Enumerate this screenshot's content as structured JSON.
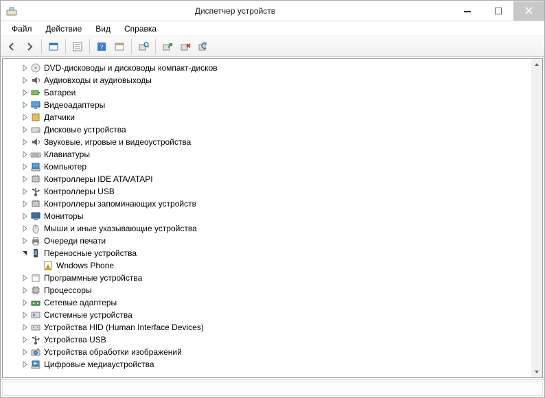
{
  "window": {
    "title": "Диспетчер устройств"
  },
  "menu": {
    "file": "Файл",
    "action": "Действие",
    "view": "Вид",
    "help": "Справка"
  },
  "tree": {
    "items": [
      {
        "label": "DVD-дисководы и дисководы компакт-дисков",
        "expanded": false,
        "icon": "disc"
      },
      {
        "label": "Аудиовходы и аудиовыходы",
        "expanded": false,
        "icon": "speaker"
      },
      {
        "label": "Батареи",
        "expanded": false,
        "icon": "battery"
      },
      {
        "label": "Видеоадаптеры",
        "expanded": false,
        "icon": "display"
      },
      {
        "label": "Датчики",
        "expanded": false,
        "icon": "sensor"
      },
      {
        "label": "Дисковые устройства",
        "expanded": false,
        "icon": "drive"
      },
      {
        "label": "Звуковые, игровые и видеоустройства",
        "expanded": false,
        "icon": "speaker"
      },
      {
        "label": "Клавиатуры",
        "expanded": false,
        "icon": "keyboard"
      },
      {
        "label": "Компьютер",
        "expanded": false,
        "icon": "computer"
      },
      {
        "label": "Контроллеры IDE ATA/ATAPI",
        "expanded": false,
        "icon": "controller"
      },
      {
        "label": "Контроллеры USB",
        "expanded": false,
        "icon": "usb"
      },
      {
        "label": "Контроллеры запоминающих устройств",
        "expanded": false,
        "icon": "controller"
      },
      {
        "label": "Мониторы",
        "expanded": false,
        "icon": "monitor"
      },
      {
        "label": "Мыши и иные указывающие устройства",
        "expanded": false,
        "icon": "mouse"
      },
      {
        "label": "Очереди печати",
        "expanded": false,
        "icon": "printer"
      },
      {
        "label": "Переносные устройства",
        "expanded": true,
        "icon": "portable",
        "children": [
          {
            "label": "Wndows Phone",
            "icon": "warning"
          }
        ]
      },
      {
        "label": "Программные устройства",
        "expanded": false,
        "icon": "software"
      },
      {
        "label": "Процессоры",
        "expanded": false,
        "icon": "cpu"
      },
      {
        "label": "Сетевые адаптеры",
        "expanded": false,
        "icon": "network"
      },
      {
        "label": "Системные устройства",
        "expanded": false,
        "icon": "system"
      },
      {
        "label": "Устройства HID (Human Interface Devices)",
        "expanded": false,
        "icon": "hid"
      },
      {
        "label": "Устройства USB",
        "expanded": false,
        "icon": "usb"
      },
      {
        "label": "Устройства обработки изображений",
        "expanded": false,
        "icon": "camera"
      },
      {
        "label": "Цифровые медиаустройства",
        "expanded": false,
        "icon": "media"
      }
    ]
  }
}
